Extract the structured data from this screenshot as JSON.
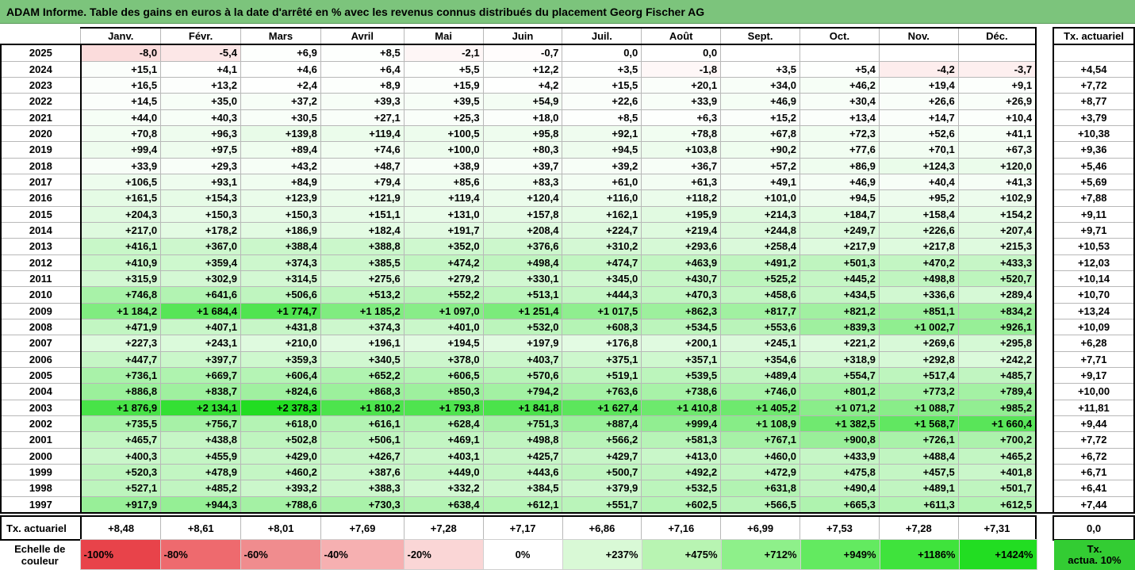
{
  "title": "ADAM Informe. Table des gains en euros à la date d'arrêté en % avec les revenus connus distribués du placement Georg Fischer AG",
  "months": [
    "Janv.",
    "Févr.",
    "Mars",
    "Avril",
    "Mai",
    "Juin",
    "Juil.",
    "Août",
    "Sept.",
    "Oct.",
    "Nov.",
    "Déc."
  ],
  "tx_header": "Tx. actuariel",
  "rows": [
    {
      "year": "2025",
      "values": [
        "-8,0",
        "-5,4",
        "+6,9",
        "+8,5",
        "-2,1",
        "-0,7",
        "0,0",
        "0,0",
        "",
        "",
        "",
        ""
      ],
      "tx": ""
    },
    {
      "year": "2024",
      "values": [
        "+15,1",
        "+4,1",
        "+4,6",
        "+6,4",
        "+5,5",
        "+12,2",
        "+3,5",
        "-1,8",
        "+3,5",
        "+5,4",
        "-4,2",
        "-3,7"
      ],
      "tx": "+4,54"
    },
    {
      "year": "2023",
      "values": [
        "+16,5",
        "+13,2",
        "+2,4",
        "+8,9",
        "+15,9",
        "+4,2",
        "+15,5",
        "+20,1",
        "+34,0",
        "+46,2",
        "+19,4",
        "+9,1"
      ],
      "tx": "+7,72"
    },
    {
      "year": "2022",
      "values": [
        "+14,5",
        "+35,0",
        "+37,2",
        "+39,3",
        "+39,5",
        "+54,9",
        "+22,6",
        "+33,9",
        "+46,9",
        "+30,4",
        "+26,6",
        "+26,9"
      ],
      "tx": "+8,77"
    },
    {
      "year": "2021",
      "values": [
        "+44,0",
        "+40,3",
        "+30,5",
        "+27,1",
        "+25,3",
        "+18,0",
        "+8,5",
        "+6,3",
        "+15,2",
        "+13,4",
        "+14,7",
        "+10,4"
      ],
      "tx": "+3,79"
    },
    {
      "year": "2020",
      "values": [
        "+70,8",
        "+96,3",
        "+139,8",
        "+119,4",
        "+100,5",
        "+95,8",
        "+92,1",
        "+78,8",
        "+67,8",
        "+72,3",
        "+52,6",
        "+41,1"
      ],
      "tx": "+10,38"
    },
    {
      "year": "2019",
      "values": [
        "+99,4",
        "+97,5",
        "+89,4",
        "+74,6",
        "+100,0",
        "+80,3",
        "+94,5",
        "+103,8",
        "+90,2",
        "+77,6",
        "+70,1",
        "+67,3"
      ],
      "tx": "+9,36"
    },
    {
      "year": "2018",
      "values": [
        "+33,9",
        "+29,3",
        "+43,2",
        "+48,7",
        "+38,9",
        "+39,7",
        "+39,2",
        "+36,7",
        "+57,2",
        "+86,9",
        "+124,3",
        "+120,0"
      ],
      "tx": "+5,46"
    },
    {
      "year": "2017",
      "values": [
        "+106,5",
        "+93,1",
        "+84,9",
        "+79,4",
        "+85,6",
        "+83,3",
        "+61,0",
        "+61,3",
        "+49,1",
        "+46,9",
        "+40,4",
        "+41,3"
      ],
      "tx": "+5,69"
    },
    {
      "year": "2016",
      "values": [
        "+161,5",
        "+154,3",
        "+123,9",
        "+121,9",
        "+119,4",
        "+120,4",
        "+116,0",
        "+118,2",
        "+101,0",
        "+94,5",
        "+95,2",
        "+102,9"
      ],
      "tx": "+7,88"
    },
    {
      "year": "2015",
      "values": [
        "+204,3",
        "+150,3",
        "+150,3",
        "+151,1",
        "+131,0",
        "+157,8",
        "+162,1",
        "+195,9",
        "+214,3",
        "+184,7",
        "+158,4",
        "+154,2"
      ],
      "tx": "+9,11"
    },
    {
      "year": "2014",
      "values": [
        "+217,0",
        "+178,2",
        "+186,9",
        "+182,4",
        "+191,7",
        "+208,4",
        "+224,7",
        "+219,4",
        "+244,8",
        "+249,7",
        "+226,6",
        "+207,4"
      ],
      "tx": "+9,71"
    },
    {
      "year": "2013",
      "values": [
        "+416,1",
        "+367,0",
        "+388,4",
        "+388,8",
        "+352,0",
        "+376,6",
        "+310,2",
        "+293,6",
        "+258,4",
        "+217,9",
        "+217,8",
        "+215,3"
      ],
      "tx": "+10,53"
    },
    {
      "year": "2012",
      "values": [
        "+410,9",
        "+359,4",
        "+374,3",
        "+385,5",
        "+474,2",
        "+498,4",
        "+474,7",
        "+463,9",
        "+491,2",
        "+501,3",
        "+470,2",
        "+433,3"
      ],
      "tx": "+12,03"
    },
    {
      "year": "2011",
      "values": [
        "+315,9",
        "+302,9",
        "+314,5",
        "+275,6",
        "+279,2",
        "+330,1",
        "+345,0",
        "+430,7",
        "+525,2",
        "+445,2",
        "+498,8",
        "+520,7"
      ],
      "tx": "+10,14"
    },
    {
      "year": "2010",
      "values": [
        "+746,8",
        "+641,6",
        "+506,6",
        "+513,2",
        "+552,2",
        "+513,1",
        "+444,3",
        "+470,3",
        "+458,6",
        "+434,5",
        "+336,6",
        "+289,4"
      ],
      "tx": "+10,70"
    },
    {
      "year": "2009",
      "values": [
        "+1 184,2",
        "+1 684,4",
        "+1 774,7",
        "+1 185,2",
        "+1 097,0",
        "+1 251,4",
        "+1 017,5",
        "+862,3",
        "+817,7",
        "+821,2",
        "+851,1",
        "+834,2"
      ],
      "tx": "+13,24"
    },
    {
      "year": "2008",
      "values": [
        "+471,9",
        "+407,1",
        "+431,8",
        "+374,3",
        "+401,0",
        "+532,0",
        "+608,3",
        "+534,5",
        "+553,6",
        "+839,3",
        "+1 002,7",
        "+926,1"
      ],
      "tx": "+10,09"
    },
    {
      "year": "2007",
      "values": [
        "+227,3",
        "+243,1",
        "+210,0",
        "+196,1",
        "+194,5",
        "+197,9",
        "+176,8",
        "+200,1",
        "+245,1",
        "+221,2",
        "+269,6",
        "+295,8"
      ],
      "tx": "+6,28"
    },
    {
      "year": "2006",
      "values": [
        "+447,7",
        "+397,7",
        "+359,3",
        "+340,5",
        "+378,0",
        "+403,7",
        "+375,1",
        "+357,1",
        "+354,6",
        "+318,9",
        "+292,8",
        "+242,2"
      ],
      "tx": "+7,71"
    },
    {
      "year": "2005",
      "values": [
        "+736,1",
        "+669,7",
        "+606,4",
        "+652,2",
        "+606,5",
        "+570,6",
        "+519,1",
        "+539,5",
        "+489,4",
        "+554,7",
        "+517,4",
        "+485,7"
      ],
      "tx": "+9,17"
    },
    {
      "year": "2004",
      "values": [
        "+886,8",
        "+838,7",
        "+824,6",
        "+868,3",
        "+850,3",
        "+794,2",
        "+763,6",
        "+738,6",
        "+746,0",
        "+801,2",
        "+773,2",
        "+789,4"
      ],
      "tx": "+10,00"
    },
    {
      "year": "2003",
      "values": [
        "+1 876,9",
        "+2 134,1",
        "+2 378,3",
        "+1 810,2",
        "+1 793,8",
        "+1 841,8",
        "+1 627,4",
        "+1 410,8",
        "+1 405,2",
        "+1 071,2",
        "+1 088,7",
        "+985,2"
      ],
      "tx": "+11,81"
    },
    {
      "year": "2002",
      "values": [
        "+735,5",
        "+756,7",
        "+618,0",
        "+616,1",
        "+628,4",
        "+751,3",
        "+887,4",
        "+999,4",
        "+1 108,9",
        "+1 382,5",
        "+1 568,7",
        "+1 660,4"
      ],
      "tx": "+9,44"
    },
    {
      "year": "2001",
      "values": [
        "+465,7",
        "+438,8",
        "+502,8",
        "+506,1",
        "+469,1",
        "+498,8",
        "+566,2",
        "+581,3",
        "+767,1",
        "+900,8",
        "+726,1",
        "+700,2"
      ],
      "tx": "+7,72"
    },
    {
      "year": "2000",
      "values": [
        "+400,3",
        "+455,9",
        "+429,0",
        "+426,7",
        "+403,1",
        "+425,7",
        "+429,7",
        "+413,0",
        "+460,0",
        "+433,9",
        "+488,4",
        "+465,2"
      ],
      "tx": "+6,72"
    },
    {
      "year": "1999",
      "values": [
        "+520,3",
        "+478,9",
        "+460,2",
        "+387,6",
        "+449,0",
        "+443,6",
        "+500,7",
        "+492,2",
        "+472,9",
        "+475,8",
        "+457,5",
        "+401,8"
      ],
      "tx": "+6,71"
    },
    {
      "year": "1998",
      "values": [
        "+527,1",
        "+485,2",
        "+393,2",
        "+388,3",
        "+332,2",
        "+384,5",
        "+379,9",
        "+532,5",
        "+631,8",
        "+490,4",
        "+489,1",
        "+501,7"
      ],
      "tx": "+6,41"
    },
    {
      "year": "1997",
      "values": [
        "+917,9",
        "+944,3",
        "+788,6",
        "+730,3",
        "+638,4",
        "+612,1",
        "+551,7",
        "+602,5",
        "+566,5",
        "+665,3",
        "+611,3",
        "+612,5"
      ],
      "tx": "+7,44"
    }
  ],
  "footer": {
    "label": "Tx. actuariel",
    "values": [
      "+8,48",
      "+8,61",
      "+8,01",
      "+7,69",
      "+7,28",
      "+7,17",
      "+6,86",
      "+7,16",
      "+6,99",
      "+7,53",
      "+7,28",
      "+7,31"
    ],
    "tx": "0,0"
  },
  "scale": {
    "label_line1": "Echelle de",
    "label_line2": "couleur",
    "items": [
      {
        "label": "-100%",
        "color": "#e8434a",
        "align": "left"
      },
      {
        "label": "-80%",
        "color": "#ee6a6e",
        "align": "left"
      },
      {
        "label": "-60%",
        "color": "#f08c8e",
        "align": "left"
      },
      {
        "label": "-40%",
        "color": "#f6b0b1",
        "align": "left"
      },
      {
        "label": "-20%",
        "color": "#fad6d6",
        "align": "left"
      },
      {
        "label": "0%",
        "color": "#ffffff",
        "align": "center"
      },
      {
        "label": "+237%",
        "color": "#d9f9d6",
        "align": "right"
      },
      {
        "label": "+475%",
        "color": "#b8f4b2",
        "align": "right"
      },
      {
        "label": "+712%",
        "color": "#8ef08a",
        "align": "right"
      },
      {
        "label": "+949%",
        "color": "#63ea60",
        "align": "right"
      },
      {
        "label": "+1186%",
        "color": "#3fe33c",
        "align": "right"
      },
      {
        "label": "+1424%",
        "color": "#22dd22",
        "align": "right"
      }
    ],
    "tx_line1": "Tx.",
    "tx_line2": "actua. 10%",
    "tx_color": "#33cc33"
  }
}
